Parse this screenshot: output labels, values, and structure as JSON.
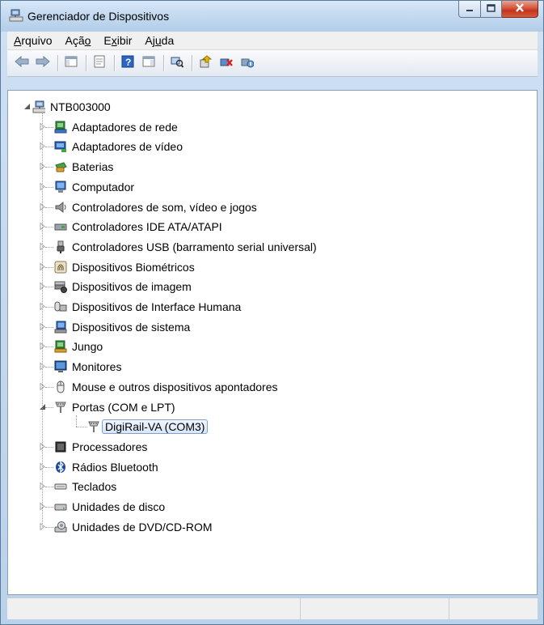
{
  "window": {
    "title": "Gerenciador de Dispositivos",
    "caption_minimize": "minimize-icon",
    "caption_maximize": "maximize-icon",
    "caption_close": "close-icon"
  },
  "menu": [
    {
      "label": "Arquivo",
      "accel_index": 0
    },
    {
      "label": "Ação",
      "accel_index": 3
    },
    {
      "label": "Exibir",
      "accel_index": 1
    },
    {
      "label": "Ajuda",
      "accel_index": 2
    }
  ],
  "toolbar": {
    "buttons": [
      "back-icon",
      "forward-icon",
      "show-hide-console-tree-icon",
      "properties-icon",
      "help-icon",
      "action-pane-icon",
      "scan-hardware-changes-icon",
      "update-driver-icon",
      "uninstall-device-icon",
      "disable-device-icon"
    ]
  },
  "tree": {
    "root": {
      "label": "NTB003000",
      "icon": "computer-network-icon",
      "expanded": true
    },
    "categories": [
      {
        "label": "Adaptadores de rede",
        "icon": "network-adapter-icon",
        "expanded": false
      },
      {
        "label": "Adaptadores de vídeo",
        "icon": "display-adapter-icon",
        "expanded": false
      },
      {
        "label": "Baterias",
        "icon": "battery-icon",
        "expanded": false
      },
      {
        "label": "Computador",
        "icon": "computer-icon",
        "expanded": false
      },
      {
        "label": "Controladores de som, vídeo e jogos",
        "icon": "speaker-icon",
        "expanded": false
      },
      {
        "label": "Controladores IDE ATA/ATAPI",
        "icon": "ide-controller-icon",
        "expanded": false
      },
      {
        "label": "Controladores USB (barramento serial universal)",
        "icon": "usb-icon",
        "expanded": false
      },
      {
        "label": "Dispositivos Biométricos",
        "icon": "fingerprint-icon",
        "expanded": false
      },
      {
        "label": "Dispositivos de imagem",
        "icon": "scanner-camera-icon",
        "expanded": false
      },
      {
        "label": "Dispositivos de Interface Humana",
        "icon": "hid-icon",
        "expanded": false
      },
      {
        "label": "Dispositivos de sistema",
        "icon": "system-device-icon",
        "expanded": false
      },
      {
        "label": "Jungo",
        "icon": "jungo-device-icon",
        "expanded": false
      },
      {
        "label": "Monitores",
        "icon": "monitor-icon",
        "expanded": false
      },
      {
        "label": "Mouse e outros dispositivos apontadores",
        "icon": "mouse-icon",
        "expanded": false
      },
      {
        "label": "Portas (COM e LPT)",
        "icon": "port-icon",
        "expanded": true,
        "children": [
          {
            "label": "DigiRail-VA (COM3)",
            "icon": "port-icon",
            "selected": true
          }
        ]
      },
      {
        "label": "Processadores",
        "icon": "processor-icon",
        "expanded": false
      },
      {
        "label": "Rádios Bluetooth",
        "icon": "bluetooth-icon",
        "expanded": false
      },
      {
        "label": "Teclados",
        "icon": "keyboard-icon",
        "expanded": false
      },
      {
        "label": "Unidades de disco",
        "icon": "disk-drive-icon",
        "expanded": false
      },
      {
        "label": "Unidades de DVD/CD-ROM",
        "icon": "dvd-drive-icon",
        "expanded": false
      }
    ]
  },
  "statusbar": {
    "cells": [
      "",
      "",
      ""
    ]
  },
  "colors": {
    "selection_border": "#7da2ce",
    "title_gradient_top": "#d7e7f7",
    "close_button": "#c5331b"
  }
}
